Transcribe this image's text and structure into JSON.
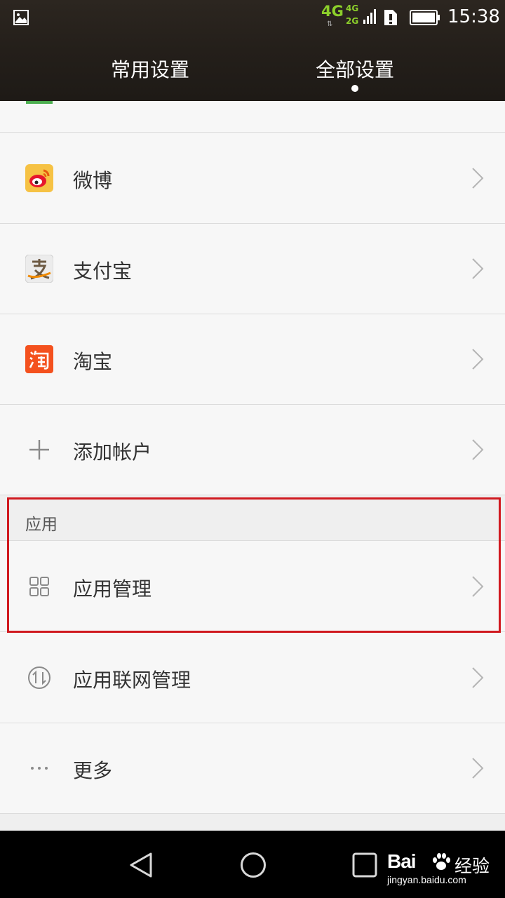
{
  "status_bar": {
    "network": "4G",
    "sim_network_top": "4G",
    "sim_network_bottom": "2G",
    "time": "15:38"
  },
  "tabs": [
    {
      "label": "常用设置",
      "selected": false
    },
    {
      "label": "全部设置",
      "selected": true
    }
  ],
  "items": [
    {
      "label": "微博",
      "icon": "weibo-icon"
    },
    {
      "label": "支付宝",
      "icon": "alipay-icon"
    },
    {
      "label": "淘宝",
      "icon": "taobao-icon"
    },
    {
      "label": "添加帐户",
      "icon": "plus-icon"
    }
  ],
  "section": {
    "title": "应用"
  },
  "app_items": [
    {
      "label": "应用管理",
      "icon": "app-grid-icon",
      "highlighted": true
    },
    {
      "label": "应用联网管理",
      "icon": "network-arrows-icon"
    },
    {
      "label": "更多",
      "icon": "more-dots-icon"
    }
  ],
  "watermark": {
    "logo": "Bai",
    "suffix": "经验",
    "url": "jingyan.baidu.com"
  },
  "colors": {
    "highlight": "#d0191f",
    "network_green": "#8ccf2b",
    "header_bg": "#241f1a"
  }
}
